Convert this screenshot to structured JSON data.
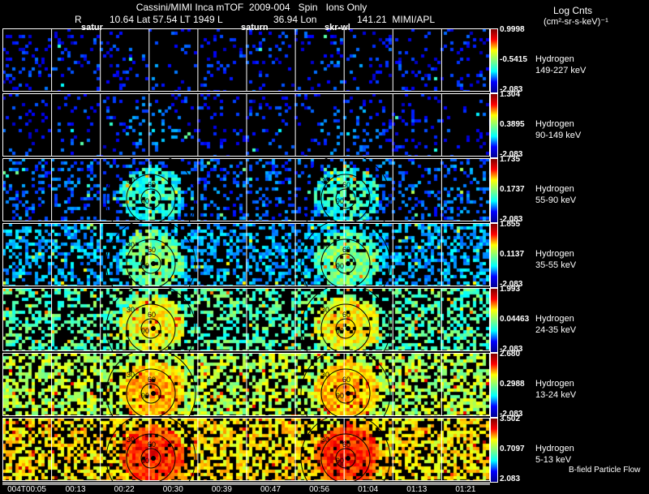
{
  "header": {
    "title": "Cassini/MIMI Inca mTOF  2009-004   Spin   Ions Only",
    "r_label": "R",
    "coords_1": "10.64 Lat 57.54 LT 1949 L",
    "coords_2": "36.94 Lon",
    "coords_3": "141.21  MIMI/APL",
    "markers": [
      "satur",
      "saturn",
      "skr-wl"
    ]
  },
  "units": {
    "line1": "Log Cnts",
    "line2": "(cm²-sr-s-keV)⁻¹"
  },
  "footer_note": "B-field Particle Flow",
  "chart_data": {
    "type": "heatmap",
    "colormap": "jet",
    "grid": true,
    "x_tick_labels": [
      "004T00:05",
      "00:13",
      "00:22",
      "00:30",
      "00:39",
      "00:47",
      "00:56",
      "01:04",
      "01:13",
      "01:21"
    ],
    "contour_labels": [
      "30",
      "60",
      "90"
    ],
    "panels": [
      {
        "species": "Hydrogen",
        "energy": "149-227 keV",
        "cmax": "0.9998",
        "cmid": "-0.5415",
        "cmin": "-2.083"
      },
      {
        "species": "Hydrogen",
        "energy": "90-149 keV",
        "cmax": "1.304",
        "cmid": "0.3895",
        "cmin": "-2.083"
      },
      {
        "species": "Hydrogen",
        "energy": "55-90 keV",
        "cmax": "1.735",
        "cmid": "0.1737",
        "cmin": "-2.083"
      },
      {
        "species": "Hydrogen",
        "energy": "35-55 keV",
        "cmax": "1.855",
        "cmid": "0.1137",
        "cmin": "-2.083"
      },
      {
        "species": "Hydrogen",
        "energy": "24-35 keV",
        "cmax": "1.993",
        "cmid": "0.04463",
        "cmin": "-2.083"
      },
      {
        "species": "Hydrogen",
        "energy": "13-24 keV",
        "cmax": "2.680",
        "cmid": "0.2988",
        "cmin": "-2.083"
      },
      {
        "species": "Hydrogen",
        "energy": "5-13 keV",
        "cmax": "3.502",
        "cmid": "0.7097",
        "cmin": "2.083"
      }
    ]
  }
}
